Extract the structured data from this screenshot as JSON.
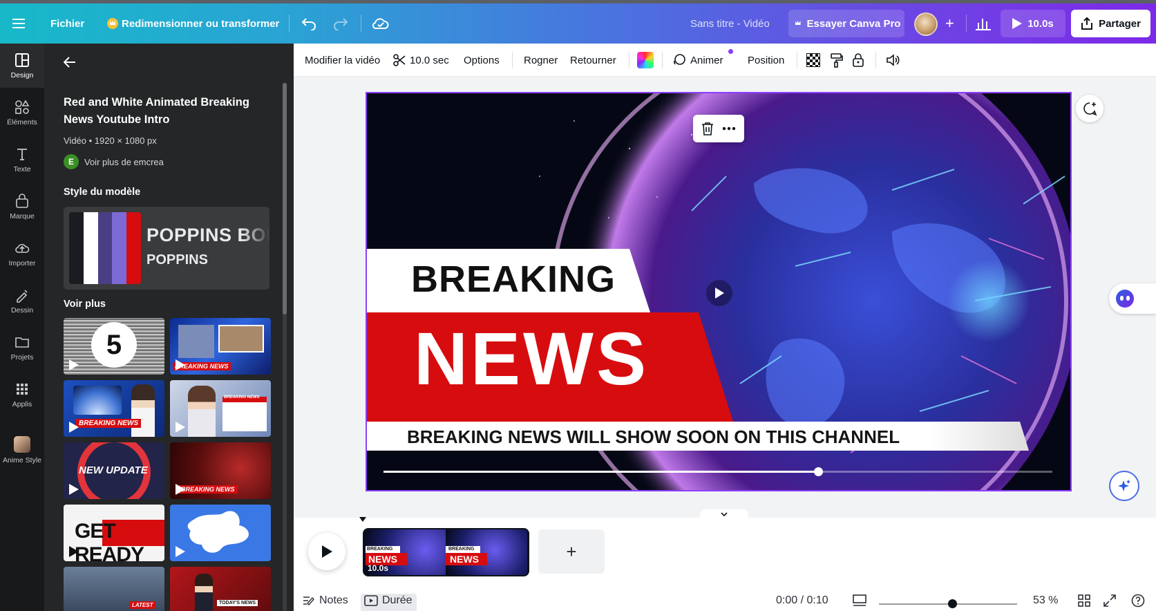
{
  "header": {
    "menu_icon": "hamburger-icon",
    "file_label": "Fichier",
    "resize_label": "Redimensionner ou transformer",
    "doc_title": "Sans titre - Vidéo",
    "pro_label": "Essayer Canva Pro",
    "play_duration": "10.0s",
    "share_label": "Partager",
    "brand_gradient": [
      "#17b9c9",
      "#7d2ae8"
    ]
  },
  "rail": {
    "items": [
      {
        "label": "Design",
        "icon": "design-icon"
      },
      {
        "label": "Éléments",
        "icon": "elements-icon"
      },
      {
        "label": "Texte",
        "icon": "text-icon"
      },
      {
        "label": "Marque",
        "icon": "brand-icon"
      },
      {
        "label": "Importer",
        "icon": "upload-icon"
      },
      {
        "label": "Dessin",
        "icon": "draw-icon"
      },
      {
        "label": "Projets",
        "icon": "folder-icon"
      },
      {
        "label": "Applis",
        "icon": "apps-icon"
      },
      {
        "label": "Anime Style",
        "icon": "anime-style-icon"
      }
    ]
  },
  "panel": {
    "template_title": "Red and White Animated Breaking News Youtube Intro",
    "meta": "Vidéo • 1920 × 1080 px",
    "author_initial": "E",
    "author_link": "Voir plus de emcrea",
    "style_heading": "Style du modèle",
    "style_swatches": [
      "#1b1b22",
      "#ffffff",
      "#4a3f86",
      "#7b6ad6",
      "#d70c0f"
    ],
    "font_heading": "POPPINS BOLD",
    "font_body": "POPPINS",
    "more_heading": "Voir plus",
    "thumbs": [
      {
        "name": "countdown",
        "text": "5"
      },
      {
        "name": "studio-news",
        "text": "BREAKING NEWS"
      },
      {
        "name": "anchor-earth",
        "text": "BREAKING NEWS"
      },
      {
        "name": "anchor-studio",
        "text": "BREAKING NEWS"
      },
      {
        "name": "new-update",
        "text": "NEW UPDATE"
      },
      {
        "name": "red-globe",
        "text": "BREAKING NEWS"
      },
      {
        "name": "get-ready",
        "text": "GET READY"
      },
      {
        "name": "blue-splash",
        "text": ""
      },
      {
        "name": "traffic-city",
        "text": "LATEST"
      },
      {
        "name": "red-presenter",
        "text": "TODAY'S NEWS"
      }
    ]
  },
  "toolbar": {
    "edit_video": "Modifier la vidéo",
    "duration": "10.0 sec",
    "options": "Options",
    "crop": "Rogner",
    "flip": "Retourner",
    "animate": "Animer",
    "position": "Position"
  },
  "canvas": {
    "line1": "BREAKING",
    "line2": "NEWS",
    "ticker": "BREAKING NEWS WILL SHOW SOON ON THIS CHANNEL",
    "video_progress": 0.65
  },
  "timeline": {
    "clip_duration": "10.0s",
    "clip_label_small": "BREAKING",
    "clip_label_big": "NEWS",
    "add_clip_label": "+"
  },
  "footer": {
    "notes": "Notes",
    "duration_tab": "Durée",
    "time": "0:00 / 0:10",
    "zoom": "53 %",
    "zoom_level": 0.53
  }
}
